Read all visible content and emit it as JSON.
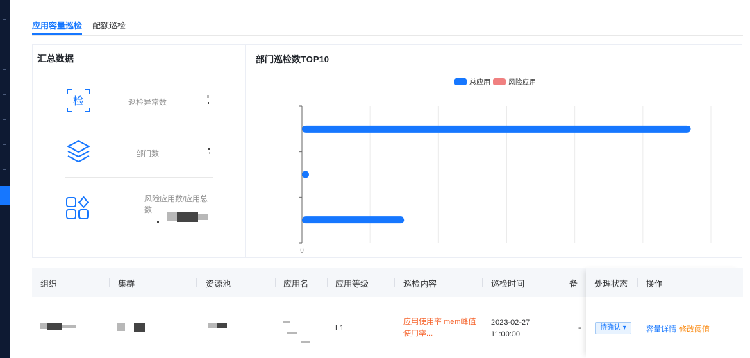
{
  "tabs": [
    {
      "label": "应用容量巡检",
      "active": true
    },
    {
      "label": "配额巡检",
      "active": false
    }
  ],
  "summary": {
    "title": "汇总数据",
    "stats": [
      {
        "label": "巡检异常数",
        "icon": "inspect-icon"
      },
      {
        "label": "部门数",
        "icon": "layers-icon"
      },
      {
        "label": "风险应用数/应用总数",
        "icon": "apps-icon"
      }
    ]
  },
  "chart_panel": {
    "title": "部门巡检数TOP10"
  },
  "chart_data": {
    "type": "bar",
    "orientation": "horizontal",
    "title": "部门巡检数TOP10",
    "legend": {
      "position": "top-right",
      "items": [
        "总应用",
        "风险应用"
      ]
    },
    "series": [
      {
        "name": "总应用",
        "color": "#1677ff",
        "values": [
          2850,
          20,
          750
        ]
      },
      {
        "name": "风险应用",
        "color": "#f08080",
        "values": [
          0,
          0,
          0
        ]
      }
    ],
    "categories": [
      "",
      "",
      ""
    ],
    "xlim": [
      0,
      3000
    ],
    "xticks": [
      "0",
      "",
      "",
      "",
      "",
      "",
      ""
    ],
    "grid": true
  },
  "table": {
    "headers": [
      "组织",
      "集群",
      "资源池",
      "应用名",
      "应用等级",
      "巡检内容",
      "巡检时间",
      "备",
      "处理状态",
      "操作"
    ],
    "row": {
      "level": "L1",
      "content": "应用使用率 mem峰值使用率...",
      "content_line1": "应用使用率 mem峰值",
      "content_line2": "使用率...",
      "time_line1": "2023-02-27",
      "time_line2": "11:00:00",
      "remark": "-",
      "status": "待确认 ▾",
      "action_detail": "容量详情",
      "action_modify": "修改阈值"
    }
  },
  "colors": {
    "accent": "#1677ff",
    "risk": "#f08080",
    "warning_text": "#f5622a",
    "action_orange": "#fa8c16"
  }
}
